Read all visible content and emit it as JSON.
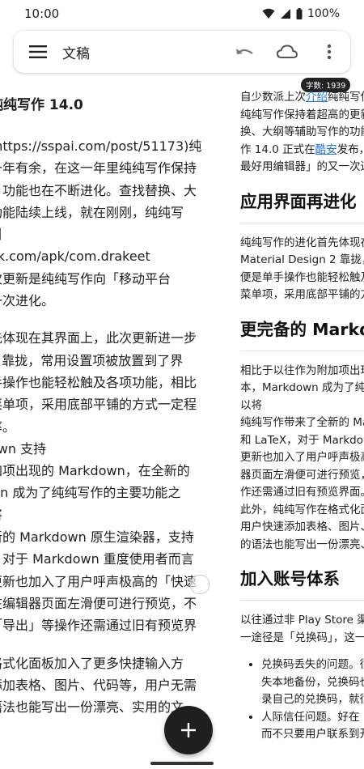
{
  "status": {
    "time": "10:00",
    "battery": "100%"
  },
  "toolbar": {
    "title": "文稿"
  },
  "word_count": "字数: 1939",
  "editor": {
    "heading": "纯纯写作 14.0",
    "paragraph1": [
      "(https://sspai.com/post/51173)纯",
      "一年有余，在这一年里纯纯写作保持",
      "，功能也在不断进化。查找替换、大",
      "功能陆续上线，就在刚刚，纯纯写",
      "引"
    ],
    "url_line": "ok.com/apk/com.drakeet",
    "paragraph2": [
      "次更新是纯纯写作向「移动平台",
      "一次进化。"
    ],
    "paragraph3": [
      "先体现在其界面上，此次更新进一步",
      "2 靠拢，常用设置项被放置到了界",
      "手操作也能轻松触及各项功能，相比",
      "菜单项，采用底部平铺的方式一定程",
      "率。"
    ],
    "md_heading": "own 支持",
    "paragraph4": [
      "加项出现的 Markdown，在全新的",
      "wn 成为了纯纯写作的主要功能之",
      "将"
    ],
    "paragraph5": [
      "新的 Markdown 原生渲染器，支持",
      "，对于 Markdown 重度使用者而言",
      "更新也加入了用户呼声极高的「快速",
      "在编辑器页面左滑便可进行预览，不",
      "「导出」等操作还需通过旧有预览界"
    ],
    "paragraph6": [
      "格式化面板加入了更多快捷输入方",
      "添加表格、图片、代码等，用户无需",
      "语法也能写出一份漂亮、实用的文"
    ]
  },
  "preview": {
    "intro_lines": [
      [
        "自少数派上次",
        "介绍",
        "纯纯写作"
      ],
      [
        "纯纯写作保持着超高的更新"
      ],
      [
        "换、大纲等辅助写作的功能"
      ],
      [
        "作 14.0 正式在",
        "酷安",
        "发布，"
      ],
      [
        "最好用编辑器」的又一次进化"
      ]
    ],
    "section1_title": "应用界面再进化",
    "section1_lines": [
      "纯纯写作的进化首先体现在其",
      "Material Design 2 靠拢，常用",
      "便是单手操作也能轻松触及各",
      "菜单项，采用底部平铺的方式"
    ],
    "section2_title": "更完备的 Markdown",
    "section2_lines_a": [
      "相比于以往作为附加项出现的",
      "本，Markdown 成为了纯纯写作",
      "以将"
    ],
    "section2_lines_b": [
      "纯纯写作带来了全新的 Mark",
      "和 LaTeX，对于 Markdown 重",
      "更新也加入了用户呼声极高的",
      "器页面左滑便可进行预览，不",
      "作还需通过旧有预览界面。",
      "此外，纯纯写作在格式化面板",
      "用户快速添加表格、图片、代",
      "的语法也能写出一份漂亮、实"
    ],
    "section3_title": "加入账号体系",
    "section3_lines": [
      "以往通过非 Play Store 渠道解锁",
      "一途径是「兑换码」，这一方式"
    ],
    "bullets": [
      [
        "兑换码丢失的问题。很多",
        "失本地备份，兑换码也就",
        "录自己的兑换码，就很容"
      ],
      [
        "人际信任问题。好在",
        "而不只要用户联系到开发"
      ]
    ]
  },
  "colors": {
    "link": "#1a73e8",
    "fab": "#1f1f1f"
  }
}
